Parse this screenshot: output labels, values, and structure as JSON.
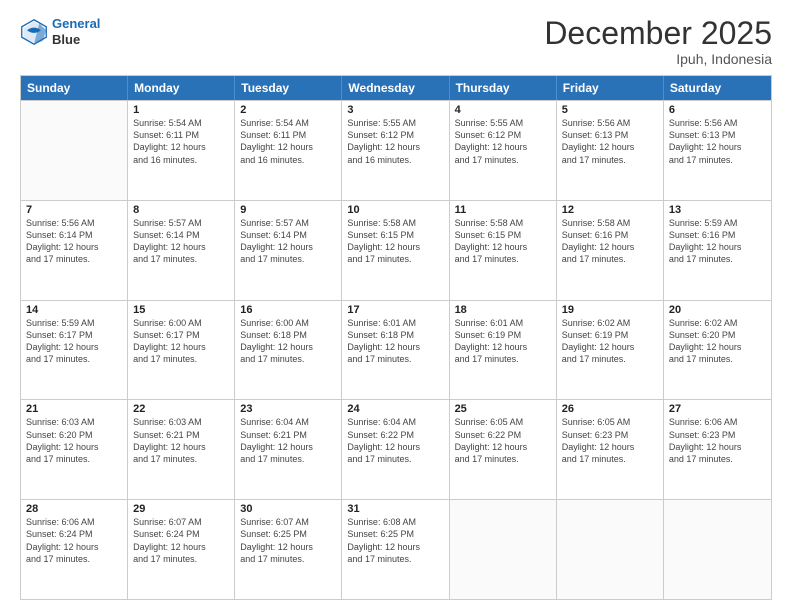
{
  "logo": {
    "line1": "General",
    "line2": "Blue"
  },
  "title": "December 2025",
  "location": "Ipuh, Indonesia",
  "days": [
    "Sunday",
    "Monday",
    "Tuesday",
    "Wednesday",
    "Thursday",
    "Friday",
    "Saturday"
  ],
  "rows": [
    [
      {
        "date": "",
        "info": ""
      },
      {
        "date": "1",
        "info": "Sunrise: 5:54 AM\nSunset: 6:11 PM\nDaylight: 12 hours\nand 16 minutes."
      },
      {
        "date": "2",
        "info": "Sunrise: 5:54 AM\nSunset: 6:11 PM\nDaylight: 12 hours\nand 16 minutes."
      },
      {
        "date": "3",
        "info": "Sunrise: 5:55 AM\nSunset: 6:12 PM\nDaylight: 12 hours\nand 16 minutes."
      },
      {
        "date": "4",
        "info": "Sunrise: 5:55 AM\nSunset: 6:12 PM\nDaylight: 12 hours\nand 17 minutes."
      },
      {
        "date": "5",
        "info": "Sunrise: 5:56 AM\nSunset: 6:13 PM\nDaylight: 12 hours\nand 17 minutes."
      },
      {
        "date": "6",
        "info": "Sunrise: 5:56 AM\nSunset: 6:13 PM\nDaylight: 12 hours\nand 17 minutes."
      }
    ],
    [
      {
        "date": "7",
        "info": ""
      },
      {
        "date": "8",
        "info": "Sunrise: 5:57 AM\nSunset: 6:14 PM\nDaylight: 12 hours\nand 17 minutes."
      },
      {
        "date": "9",
        "info": "Sunrise: 5:57 AM\nSunset: 6:14 PM\nDaylight: 12 hours\nand 17 minutes."
      },
      {
        "date": "10",
        "info": "Sunrise: 5:58 AM\nSunset: 6:15 PM\nDaylight: 12 hours\nand 17 minutes."
      },
      {
        "date": "11",
        "info": "Sunrise: 5:58 AM\nSunset: 6:15 PM\nDaylight: 12 hours\nand 17 minutes."
      },
      {
        "date": "12",
        "info": "Sunrise: 5:58 AM\nSunset: 6:16 PM\nDaylight: 12 hours\nand 17 minutes."
      },
      {
        "date": "13",
        "info": "Sunrise: 5:59 AM\nSunset: 6:16 PM\nDaylight: 12 hours\nand 17 minutes."
      }
    ],
    [
      {
        "date": "14",
        "info": ""
      },
      {
        "date": "15",
        "info": "Sunrise: 6:00 AM\nSunset: 6:17 PM\nDaylight: 12 hours\nand 17 minutes."
      },
      {
        "date": "16",
        "info": "Sunrise: 6:00 AM\nSunset: 6:18 PM\nDaylight: 12 hours\nand 17 minutes."
      },
      {
        "date": "17",
        "info": "Sunrise: 6:01 AM\nSunset: 6:18 PM\nDaylight: 12 hours\nand 17 minutes."
      },
      {
        "date": "18",
        "info": "Sunrise: 6:01 AM\nSunset: 6:19 PM\nDaylight: 12 hours\nand 17 minutes."
      },
      {
        "date": "19",
        "info": "Sunrise: 6:02 AM\nSunset: 6:19 PM\nDaylight: 12 hours\nand 17 minutes."
      },
      {
        "date": "20",
        "info": "Sunrise: 6:02 AM\nSunset: 6:20 PM\nDaylight: 12 hours\nand 17 minutes."
      }
    ],
    [
      {
        "date": "21",
        "info": ""
      },
      {
        "date": "22",
        "info": "Sunrise: 6:03 AM\nSunset: 6:21 PM\nDaylight: 12 hours\nand 17 minutes."
      },
      {
        "date": "23",
        "info": "Sunrise: 6:04 AM\nSunset: 6:21 PM\nDaylight: 12 hours\nand 17 minutes."
      },
      {
        "date": "24",
        "info": "Sunrise: 6:04 AM\nSunset: 6:22 PM\nDaylight: 12 hours\nand 17 minutes."
      },
      {
        "date": "25",
        "info": "Sunrise: 6:05 AM\nSunset: 6:22 PM\nDaylight: 12 hours\nand 17 minutes."
      },
      {
        "date": "26",
        "info": "Sunrise: 6:05 AM\nSunset: 6:23 PM\nDaylight: 12 hours\nand 17 minutes."
      },
      {
        "date": "27",
        "info": "Sunrise: 6:06 AM\nSunset: 6:23 PM\nDaylight: 12 hours\nand 17 minutes."
      }
    ],
    [
      {
        "date": "28",
        "info": ""
      },
      {
        "date": "29",
        "info": "Sunrise: 6:07 AM\nSunset: 6:24 PM\nDaylight: 12 hours\nand 17 minutes."
      },
      {
        "date": "30",
        "info": "Sunrise: 6:07 AM\nSunset: 6:25 PM\nDaylight: 12 hours\nand 17 minutes."
      },
      {
        "date": "31",
        "info": "Sunrise: 6:08 AM\nSunset: 6:25 PM\nDaylight: 12 hours\nand 17 minutes."
      },
      {
        "date": "",
        "info": ""
      },
      {
        "date": "",
        "info": ""
      },
      {
        "date": "",
        "info": ""
      }
    ]
  ],
  "row0_info": {
    "d7": "Sunrise: 5:56 AM\nSunset: 6:14 PM\nDaylight: 12 hours\nand 17 minutes.",
    "d14": "Sunrise: 5:59 AM\nSunset: 6:17 PM\nDaylight: 12 hours\nand 17 minutes.",
    "d21": "Sunrise: 6:03 AM\nSunset: 6:20 PM\nDaylight: 12 hours\nand 17 minutes.",
    "d28": "Sunrise: 6:06 AM\nSunset: 6:24 PM\nDaylight: 12 hours\nand 17 minutes."
  }
}
